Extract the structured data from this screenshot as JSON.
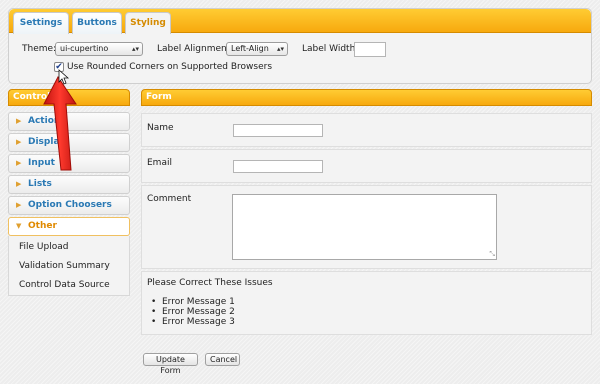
{
  "tabs": [
    {
      "label": "Settings",
      "active": false
    },
    {
      "label": "Buttons",
      "active": false
    },
    {
      "label": "Styling",
      "active": true
    }
  ],
  "styling": {
    "theme_label": "Theme:",
    "theme_value": "ui-cupertino",
    "alignment_label": "Label Alignment:",
    "alignment_value": "Left-Align",
    "width_label": "Label Width:",
    "width_value": "",
    "rounded_checked": true,
    "rounded_label": "Use Rounded Corners on Supported Browsers"
  },
  "controls": {
    "title": "Controls",
    "items": [
      {
        "label": "Actions",
        "icon": "triangle-right-icon",
        "active": false
      },
      {
        "label": "Display",
        "icon": "triangle-right-icon",
        "active": false
      },
      {
        "label": "Input",
        "icon": "triangle-right-icon",
        "active": false
      },
      {
        "label": "Lists",
        "icon": "triangle-right-icon",
        "active": false
      },
      {
        "label": "Option Choosers",
        "icon": "triangle-right-icon",
        "active": false
      },
      {
        "label": "Other",
        "icon": "triangle-down-icon",
        "active": true
      }
    ],
    "other_items": [
      "File Upload",
      "Validation Summary",
      "Control Data Source"
    ]
  },
  "form": {
    "title": "Form",
    "name_label": "Name",
    "name_value": "",
    "email_label": "Email",
    "email_value": "",
    "comment_label": "Comment",
    "comment_value": "",
    "errors_title": "Please Correct These Issues",
    "errors": [
      "Error Message 1",
      "Error Message 2",
      "Error Message 3"
    ],
    "update_button": "Update Form",
    "cancel_button": "Cancel"
  },
  "colors": {
    "header_orange": "#f7a90e",
    "link_blue": "#2a79b4",
    "active_orange": "#e08a00",
    "annotation_red": "#e8231a"
  }
}
